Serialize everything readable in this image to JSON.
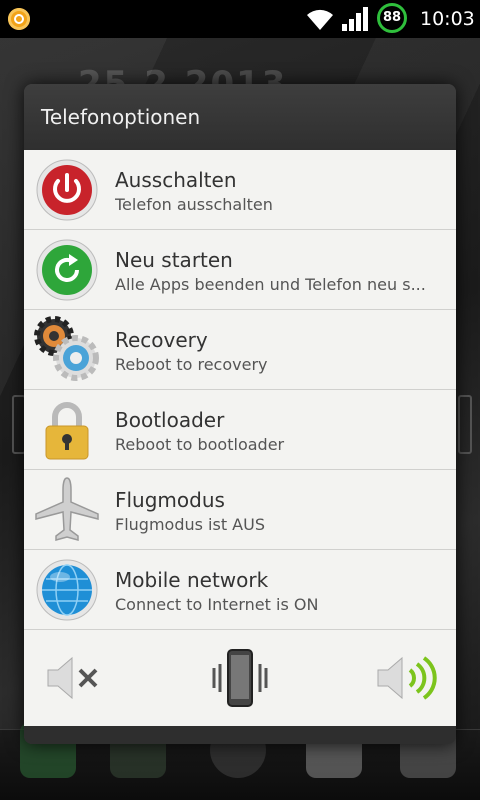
{
  "status_bar": {
    "time": "10:03",
    "battery_level": "88",
    "icons": [
      "app-notification-icon",
      "wifi-icon",
      "signal-icon",
      "battery-icon"
    ],
    "colors": {
      "battery_ring": "#2fbf3c",
      "app_icon": "#f2a318"
    }
  },
  "dialog": {
    "title": "Telefonoptionen",
    "options": [
      {
        "icon": "power-icon",
        "title": "Ausschalten",
        "subtitle": "Telefon ausschalten"
      },
      {
        "icon": "restart-icon",
        "title": "Neu starten",
        "subtitle": "Alle Apps beenden und Telefon neu s..."
      },
      {
        "icon": "gears-icon",
        "title": "Recovery",
        "subtitle": "Reboot to recovery"
      },
      {
        "icon": "lock-icon",
        "title": "Bootloader",
        "subtitle": "Reboot to bootloader"
      },
      {
        "icon": "airplane-icon",
        "title": "Flugmodus",
        "subtitle": "Flugmodus ist AUS"
      },
      {
        "icon": "globe-icon",
        "title": "Mobile network",
        "subtitle": "Connect to Internet is ON"
      }
    ],
    "sound_modes": [
      {
        "icon": "mute-icon",
        "state": "inactive"
      },
      {
        "icon": "vibrate-icon",
        "state": "inactive"
      },
      {
        "icon": "sound-on-icon",
        "state": "active"
      }
    ],
    "colors": {
      "power": "#c8232b",
      "restart": "#2ea63a",
      "globe": "#1f8fd6",
      "sound_active": "#7cc41c"
    }
  },
  "background": {
    "date_text": "25.2.2013"
  }
}
